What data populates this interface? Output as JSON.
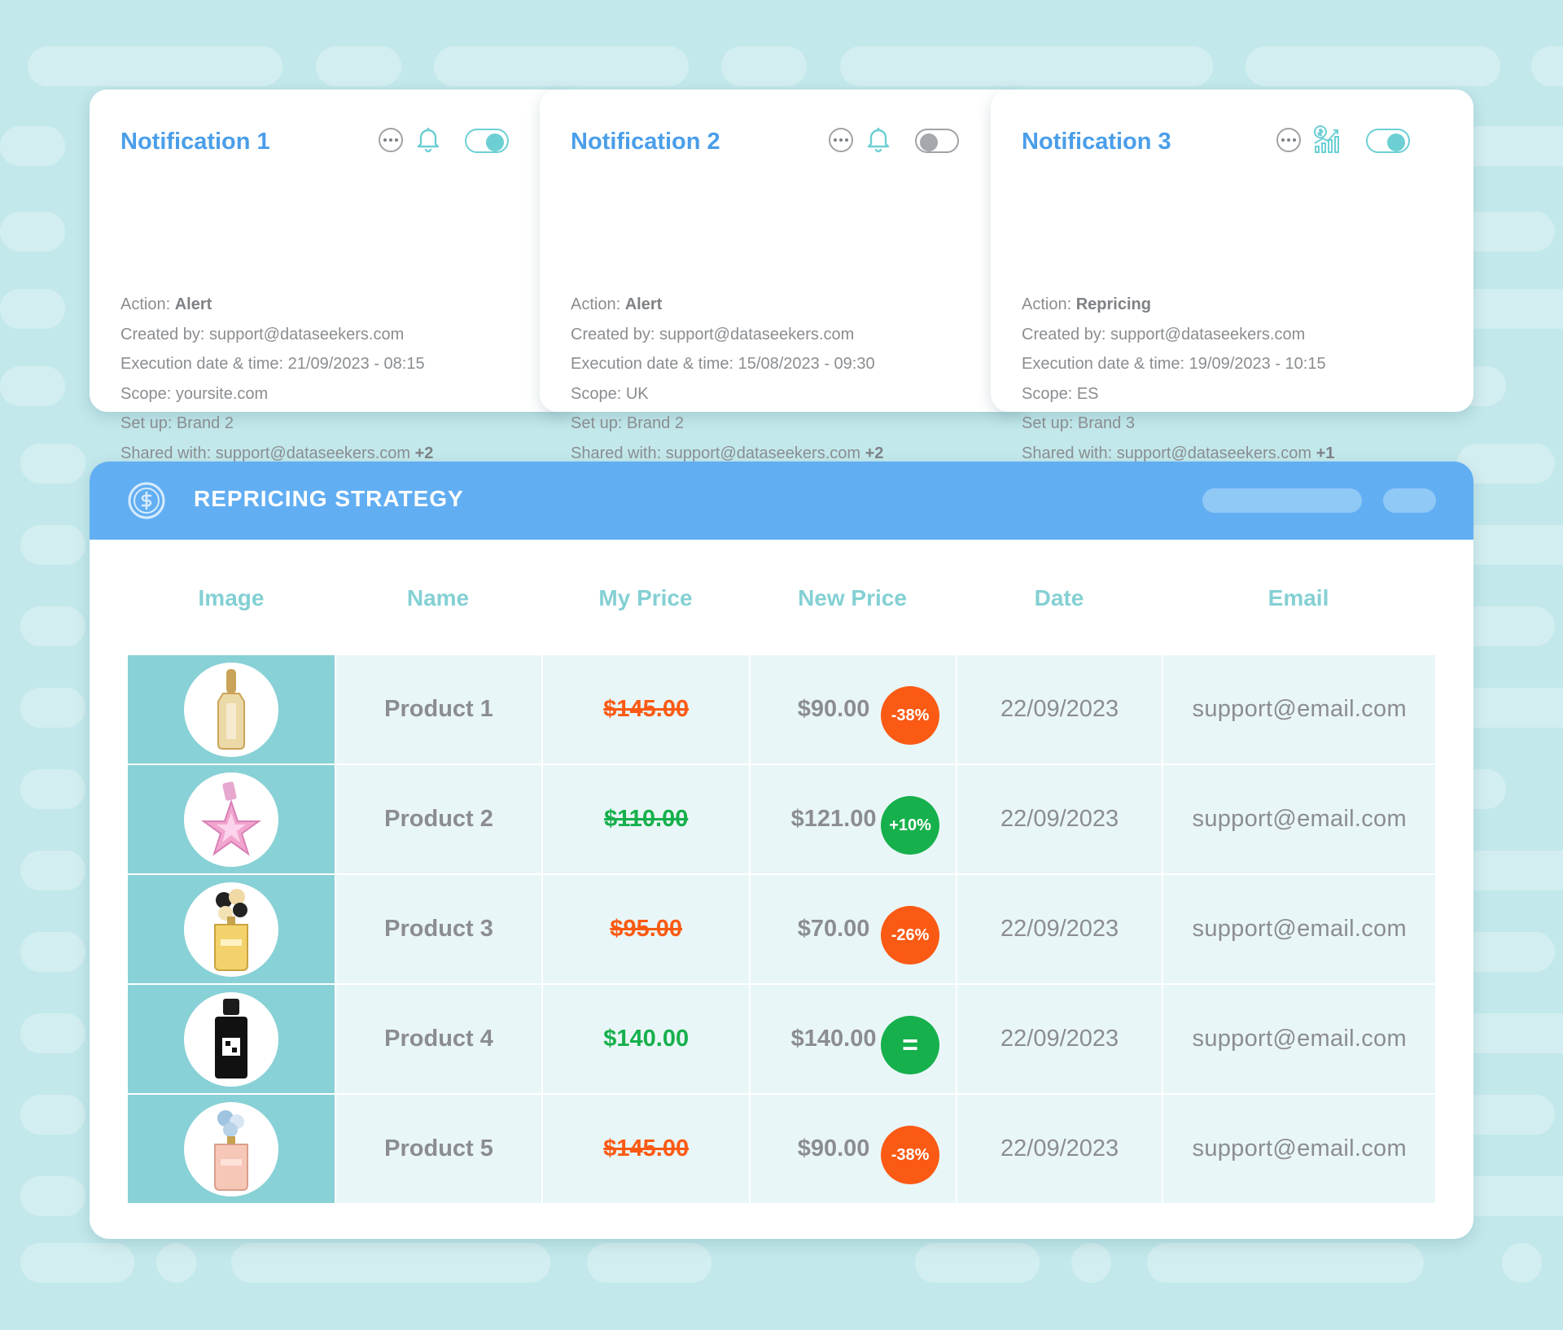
{
  "notifications": [
    {
      "title": "Notification 1",
      "enabled": true,
      "icon": "bell-icon",
      "action_label": "Action:",
      "action_value": "Alert",
      "created_by": "Created by: support@dataseekers.com",
      "execution": "Execution date & time: 21/09/2023 - 08:15",
      "scope": "Scope: yoursite.com",
      "setup": "Set up: Brand 2",
      "shared_label": "Shared with: support@dataseekers.com",
      "shared_extra": "+2"
    },
    {
      "title": "Notification 2",
      "enabled": false,
      "icon": "bell-icon",
      "action_label": "Action:",
      "action_value": "Alert",
      "created_by": "Created by: support@dataseekers.com",
      "execution": "Execution date & time: 15/08/2023 - 09:30",
      "scope": "Scope: UK",
      "setup": "Set up: Brand 2",
      "shared_label": "Shared with: support@dataseekers.com",
      "shared_extra": "+2"
    },
    {
      "title": "Notification 3",
      "enabled": true,
      "icon": "price-chart-icon",
      "action_label": "Action:",
      "action_value": "Repricing",
      "created_by": "Created by: support@dataseekers.com",
      "execution": "Execution date & time: 19/09/2023 - 10:15",
      "scope": "Scope: ES",
      "setup": "Set up: Brand 3",
      "shared_label": "Shared with: support@dataseekers.com",
      "shared_extra": "+1"
    }
  ],
  "repricing": {
    "title": "REPRICING STRATEGY",
    "columns": [
      "Image",
      "Name",
      "My Price",
      "New Price",
      "Date",
      "Email"
    ],
    "rows": [
      {
        "name": "Product 1",
        "my_price": "$145.00",
        "my_price_struck": true,
        "my_price_color": "#fa5a14",
        "new_price": "$90.00",
        "badge": "-38%",
        "badge_color": "#fa5a14",
        "date": "22/09/2023",
        "email": "support@email.com",
        "image": "perfume-bottle-gold-icon"
      },
      {
        "name": "Product 2",
        "my_price": "$110.00",
        "my_price_struck": true,
        "my_price_color": "#16b04c",
        "new_price": "$121.00",
        "badge": "+10%",
        "badge_color": "#16b04c",
        "date": "22/09/2023",
        "email": "support@email.com",
        "image": "perfume-bottle-star-icon"
      },
      {
        "name": "Product 3",
        "my_price": "$95.00",
        "my_price_struck": true,
        "my_price_color": "#fa5a14",
        "new_price": "$70.00",
        "badge": "-26%",
        "badge_color": "#fa5a14",
        "date": "22/09/2023",
        "email": "support@email.com",
        "image": "perfume-bottle-flower-icon"
      },
      {
        "name": "Product 4",
        "my_price": "$140.00",
        "my_price_struck": false,
        "my_price_color": "#16b04c",
        "new_price": "$140.00",
        "badge": "=",
        "badge_color": "#16b04c",
        "date": "22/09/2023",
        "email": "support@email.com",
        "image": "perfume-bottle-black-icon"
      },
      {
        "name": "Product 5",
        "my_price": "$145.00",
        "my_price_struck": true,
        "my_price_color": "#fa5a14",
        "new_price": "$90.00",
        "badge": "-38%",
        "badge_color": "#fa5a14",
        "date": "22/09/2023",
        "email": "support@email.com",
        "image": "perfume-bottle-pink-icon"
      }
    ]
  },
  "colors": {
    "background": "#c2e8eb",
    "title_blue": "#4a9ee9",
    "header_blue": "#62aef2",
    "accent_teal": "#6ccfd4",
    "decrease_orange": "#fa5a14",
    "increase_green": "#16b04c"
  }
}
